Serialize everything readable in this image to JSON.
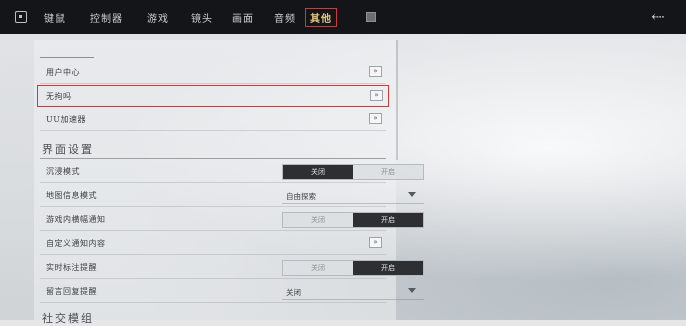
{
  "topbar": {
    "tabs": [
      "键鼠",
      "控制器",
      "游戏",
      "镜头",
      "画面",
      "音频",
      "其他"
    ],
    "active_tab": "其他",
    "home_icon": "home-square-icon",
    "square_icon": "panel-icon",
    "back_icon": "back-arrow-icon"
  },
  "rows": {
    "user_center": "用户中心",
    "wuju": "无拘吗",
    "uu_accelerator": "UU加速器",
    "arrow": "»"
  },
  "interface": {
    "title": "界面设置",
    "mode": {
      "label": "沉浸模式",
      "off": "关闭",
      "on": "开启",
      "value": "关闭"
    },
    "map_mode": {
      "label": "地图信息模式",
      "value": "自由探索"
    },
    "popup": {
      "label": "游戏内横幅通知",
      "off": "关闭",
      "on": "开启",
      "value": "开启"
    },
    "custom_text": {
      "label": "自定义通知内容"
    },
    "realtime": {
      "label": "实时标注提醒",
      "off": "关闭",
      "on": "开启",
      "value": "开启"
    },
    "reply": {
      "label": "留言回复提醒",
      "value": "关闭"
    }
  },
  "bottom_section": {
    "title": "社交模组"
  },
  "colors": {
    "highlight": "#d8323a",
    "active_tab_text": "#e8c77a",
    "topbar": "#141518"
  }
}
